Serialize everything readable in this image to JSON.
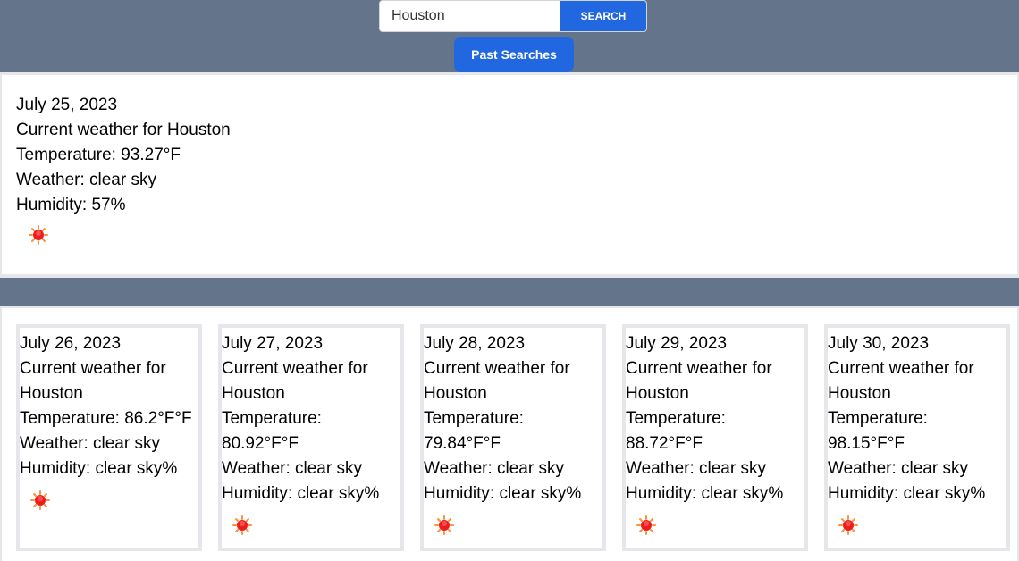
{
  "header": {
    "search_value": "Houston",
    "search_label": "SEARCH",
    "past_searches_label": "Past Searches"
  },
  "current": {
    "date": "July 25, 2023",
    "title": "Current weather for Houston",
    "temperature": "Temperature: 93.27°F",
    "weather": "Weather: clear sky",
    "humidity": "Humidity: 57%",
    "icon": "sun-icon"
  },
  "forecast": [
    {
      "date": "July 26, 2023",
      "title": "Current weather for Houston",
      "temperature": "Temperature: 86.2°F°F",
      "weather": "Weather: clear sky",
      "humidity": "Humidity: clear sky%",
      "icon": "sun-icon"
    },
    {
      "date": "July 27, 2023",
      "title": "Current weather for Houston",
      "temperature": "Temperature: 80.92°F°F",
      "weather": "Weather: clear sky",
      "humidity": "Humidity: clear sky%",
      "icon": "sun-icon"
    },
    {
      "date": "July 28, 2023",
      "title": "Current weather for Houston",
      "temperature": "Temperature: 79.84°F°F",
      "weather": "Weather: clear sky",
      "humidity": "Humidity: clear sky%",
      "icon": "sun-icon"
    },
    {
      "date": "July 29, 2023",
      "title": "Current weather for Houston",
      "temperature": "Temperature: 88.72°F°F",
      "weather": "Weather: clear sky",
      "humidity": "Humidity: clear sky%",
      "icon": "sun-icon"
    },
    {
      "date": "July 30, 2023",
      "title": "Current weather for Houston",
      "temperature": "Temperature: 98.15°F°F",
      "weather": "Weather: clear sky",
      "humidity": "Humidity: clear sky%",
      "icon": "sun-icon"
    }
  ],
  "colors": {
    "header": "#64748b",
    "button": "#2067e0"
  }
}
